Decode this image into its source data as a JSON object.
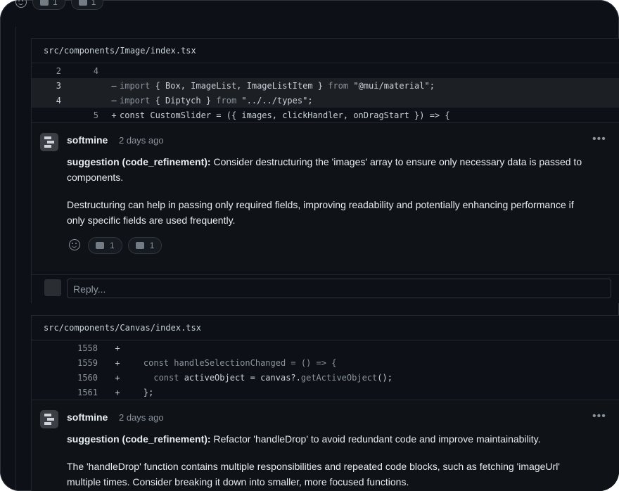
{
  "top_reactions": {
    "thumbs_up_count": "1",
    "thumbs_down_count": "1"
  },
  "threads": [
    {
      "file_path": "src/components/Image/index.tsx",
      "diff_lines": [
        {
          "old": "2",
          "new": "4",
          "sign": "",
          "pre": "",
          "kw1": "",
          "mid": "",
          "kw2": "",
          "post": ""
        },
        {
          "old": "3",
          "new": "",
          "sign": "–",
          "pre": "",
          "kw1": "import",
          "mid": " { Box, ImageList, ImageListItem } ",
          "kw2": "from",
          "post": " \"@mui/material\";"
        },
        {
          "old": "4",
          "new": "",
          "sign": "–",
          "pre": "",
          "kw1": "import",
          "mid": " { Diptych } ",
          "kw2": "from",
          "post": " \"../../types\";"
        },
        {
          "old": "",
          "new": "5",
          "sign": "+",
          "pre": "const CustomSlider = ({ images, clickHandler, onDragStart }) => {",
          "kw1": "",
          "mid": "",
          "kw2": "",
          "post": ""
        }
      ],
      "comment": {
        "author": "softmine",
        "time": "2 days ago",
        "label": "suggestion (code_refinement):",
        "lead": " Consider destructuring the 'images' array to ensure only necessary data is passed to components.",
        "body": "Destructuring can help in passing only required fields, improving readability and potentially enhancing performance if only specific fields are used frequently.",
        "thumbs_up_count": "1",
        "thumbs_down_count": "1"
      },
      "reply_placeholder": "Reply..."
    },
    {
      "file_path": "src/components/Canvas/index.tsx",
      "diff_lines": [
        {
          "old": "",
          "new": "1558",
          "sign": "+",
          "pre": "",
          "kw1": "",
          "mid": "",
          "kw2": "",
          "post": ""
        },
        {
          "old": "",
          "new": "1559",
          "sign": "+",
          "pre": "    ",
          "kw1": "const handleSelectionChanged = () => {",
          "mid": "",
          "kw2": "",
          "post": ""
        },
        {
          "old": "",
          "new": "1560",
          "sign": "+",
          "pre": "      ",
          "kw1": "const",
          "mid": " activeObject = canvas?.",
          "kw2": "getActiveObject",
          "post": "();"
        },
        {
          "old": "",
          "new": "1561",
          "sign": "+",
          "pre": "    };",
          "kw1": "",
          "mid": "",
          "kw2": "",
          "post": ""
        }
      ],
      "comment": {
        "author": "softmine",
        "time": "2 days ago",
        "label": "suggestion (code_refinement):",
        "lead": " Refactor 'handleDrop' to avoid redundant code and improve maintainability.",
        "body": "The 'handleDrop' function contains multiple responsibilities and repeated code blocks, such as fetching 'imageUrl' multiple times. Consider breaking it down into smaller, more focused functions."
      }
    }
  ],
  "icons": {
    "more": "ellipsis-icon",
    "smile": "smiley-icon",
    "up": "thumbs-up-icon",
    "down": "thumbs-down-icon"
  }
}
